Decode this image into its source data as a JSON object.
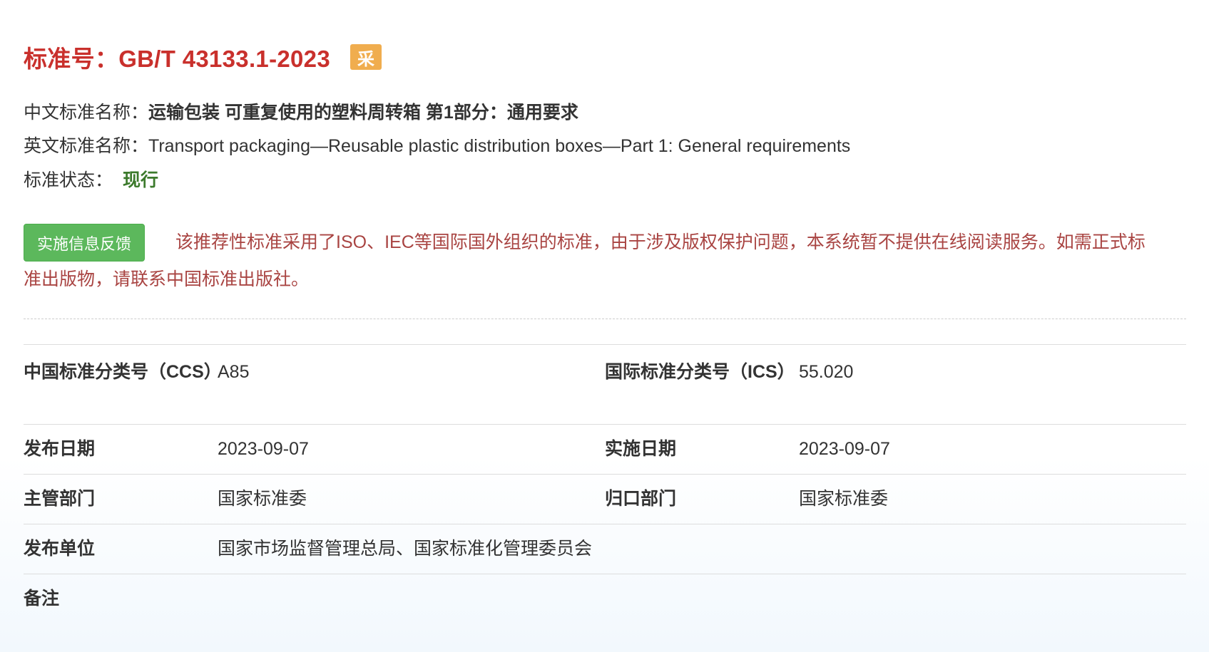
{
  "header": {
    "title_prefix": "标准号：",
    "standard_number": "GB/T 43133.1-2023",
    "badge": "采"
  },
  "info": {
    "cn_name_label": "中文标准名称：",
    "cn_name_value": "运输包装 可重复使用的塑料周转箱 第1部分：通用要求",
    "en_name_label": "英文标准名称：",
    "en_name_value": "Transport packaging—Reusable plastic distribution boxes—Part 1: General requirements",
    "status_label": "标准状态：",
    "status_value": "现行"
  },
  "actions": {
    "feedback_label": "实施信息反馈"
  },
  "notice": "该推荐性标准采用了ISO、IEC等国际国外组织的标准，由于涉及版权保护问题，本系统暂不提供在线阅读服务。如需正式标准出版物，请联系中国标准出版社。",
  "details": {
    "ccs_label": "中国标准分类号（CCS）",
    "ccs_value": "A85",
    "ics_label": "国际标准分类号（ICS）",
    "ics_value": "55.020",
    "publish_date_label": "发布日期",
    "publish_date_value": "2023-09-07",
    "implement_date_label": "实施日期",
    "implement_date_value": "2023-09-07",
    "authority_label": "主管部门",
    "authority_value": "国家标准委",
    "admin_label": "归口部门",
    "admin_value": "国家标准委",
    "publisher_label": "发布单位",
    "publisher_value": "国家市场监督管理总局、国家标准化管理委员会",
    "remarks_label": "备注",
    "remarks_value": ""
  },
  "colors": {
    "title_red": "#c9302c",
    "badge_orange": "#f0ad4e",
    "status_green": "#3c7a2c",
    "button_green": "#5cb85c",
    "notice_red": "#a94442"
  }
}
